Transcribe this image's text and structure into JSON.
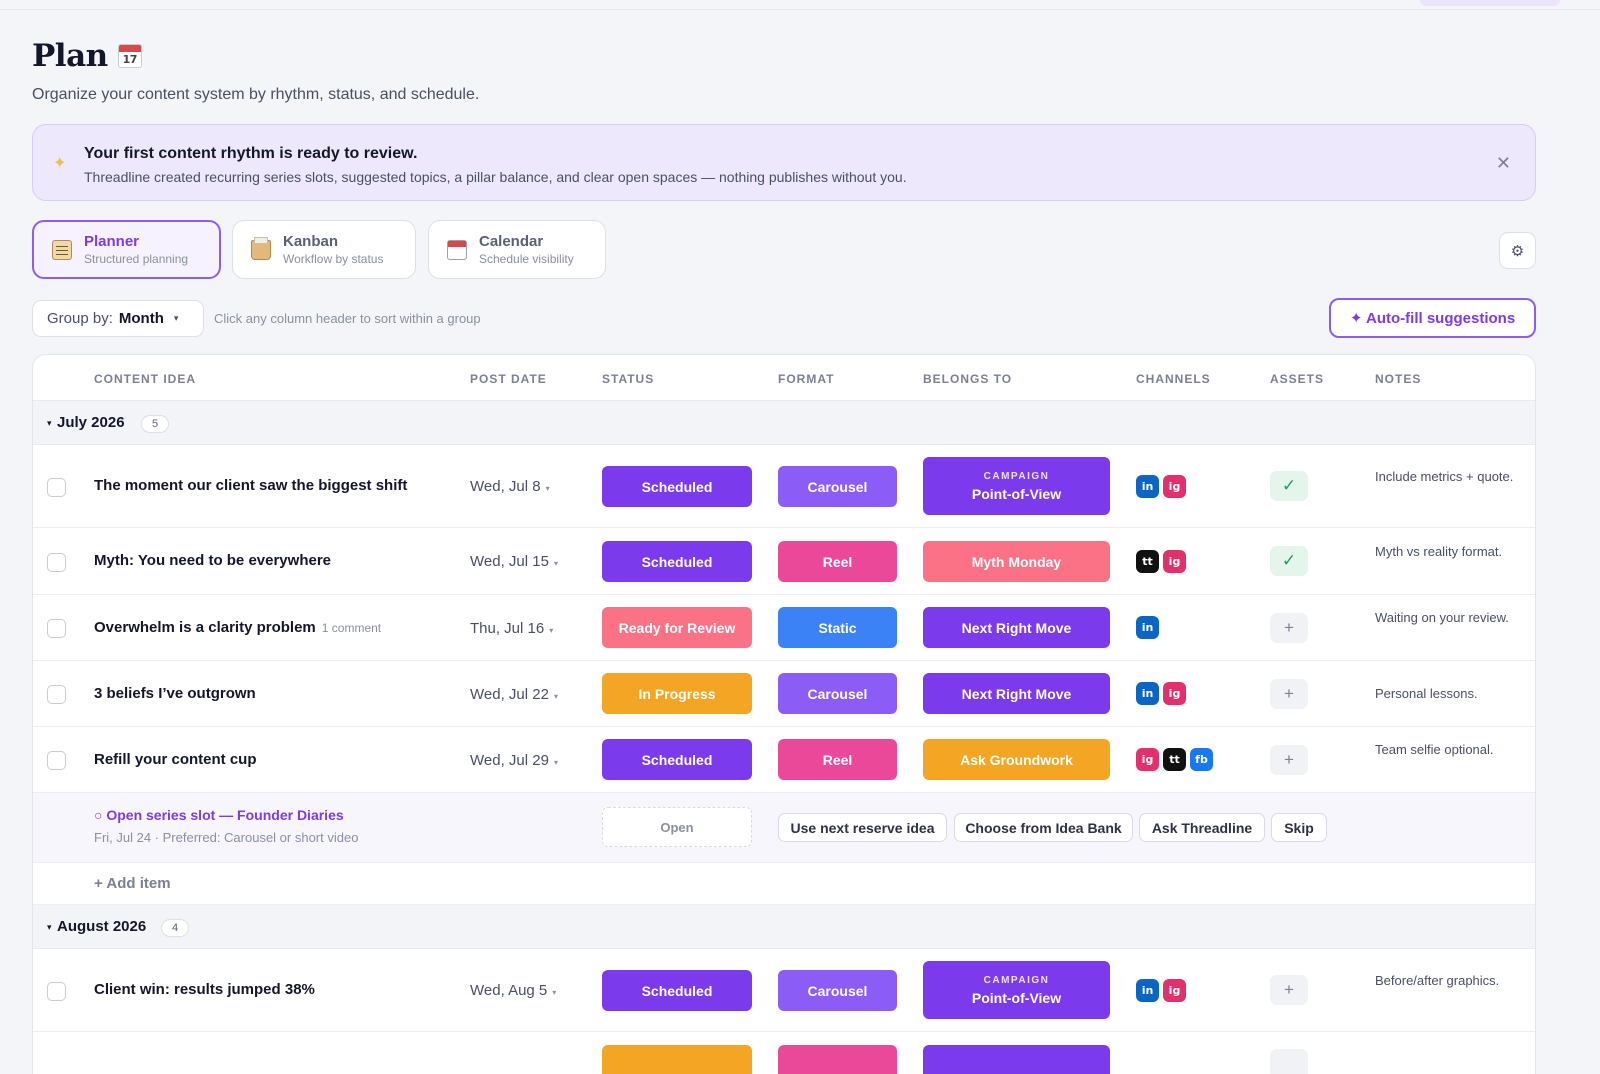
{
  "page": {
    "title": "Plan",
    "title_icon_text": "17",
    "subtitle": "Organize your content system by rhythm, status, and schedule."
  },
  "banner": {
    "icon": "sparkle-icon",
    "title": "Your first content rhythm is ready to review.",
    "text": "Threadline created recurring series slots, suggested topics, a pillar balance, and clear open spaces — nothing publishes without you.",
    "close": "✕"
  },
  "views": [
    {
      "label": "Planner",
      "sub": "Structured planning",
      "icon": "clipboard-icon"
    },
    {
      "label": "Kanban",
      "sub": "Workflow by status",
      "icon": "card-box-icon"
    },
    {
      "label": "Calendar",
      "sub": "Schedule visibility",
      "icon": "calendar-icon"
    }
  ],
  "settings_icon": "⚙",
  "toolbar": {
    "groupby_label": "Group by:",
    "groupby_value": "Month",
    "groupby_caret": "▾",
    "sort_hint": "Click any column header to sort within a group",
    "autofill": "✦ Auto-fill suggestions"
  },
  "columns": [
    "CONTENT IDEA",
    "POST DATE",
    "STATUS",
    "FORMAT",
    "BELONGS TO",
    "CHANNELS",
    "ASSETS",
    "NOTES"
  ],
  "colors": {
    "scheduled": "#7c3aed",
    "ready_for_review": "#fb7185",
    "in_progress": "#f5a524",
    "carousel": "#8b5cf6",
    "reel": "#ec4899",
    "static": "#3b82f6",
    "campaign": "#7c3aed",
    "myth_monday": "#fb7185",
    "next_right_move": "#7c3aed",
    "ask_groundwork": "#f5a524"
  },
  "groups": [
    {
      "label": "July 2026",
      "count": "5",
      "caret": "▾",
      "rows": [
        {
          "title": "The moment our client saw the biggest shift",
          "comment": "",
          "date": "Wed, Jul 8",
          "status": "Scheduled",
          "format": "Carousel",
          "belongs_tag": "CAMPAIGN",
          "belongs": "Point-of-View",
          "channels": [
            "in",
            "ig"
          ],
          "asset": "✓",
          "notes": "Include metrics + quote."
        },
        {
          "title": "Myth: You need to be everywhere",
          "comment": "",
          "date": "Wed, Jul 15",
          "status": "Scheduled",
          "format": "Reel",
          "belongs_tag": "",
          "belongs": "Myth Monday",
          "channels": [
            "tt",
            "ig"
          ],
          "asset": "✓",
          "notes": "Myth vs reality format."
        },
        {
          "title": "Overwhelm is a clarity problem",
          "comment": "1 comment",
          "date": "Thu, Jul 16",
          "status": "Ready for Review",
          "format": "Static",
          "belongs_tag": "",
          "belongs": "Next Right Move",
          "channels": [
            "in"
          ],
          "asset": "+",
          "notes": "Waiting on your review."
        },
        {
          "title": "3 beliefs I’ve outgrown",
          "comment": "",
          "date": "Wed, Jul 22",
          "status": "In Progress",
          "format": "Carousel",
          "belongs_tag": "",
          "belongs": "Next Right Move",
          "channels": [
            "in",
            "ig"
          ],
          "asset": "+",
          "notes": "Personal lessons."
        },
        {
          "title": "Refill your content cup",
          "comment": "",
          "date": "Wed, Jul 29",
          "status": "Scheduled",
          "format": "Reel",
          "belongs_tag": "",
          "belongs": "Ask Groundwork",
          "channels": [
            "ig",
            "tt",
            "fb"
          ],
          "asset": "+",
          "notes": "Team selfie optional."
        }
      ],
      "slot": {
        "title": "○ Open series slot — Founder Diaries",
        "sub": "Fri, Jul 24 · Preferred: Carousel or short video",
        "status": "Open",
        "actions": [
          "Use next reserve idea",
          "Choose from Idea Bank",
          "Ask Threadline",
          "Skip"
        ]
      },
      "add_item": "+ Add item"
    },
    {
      "label": "August 2026",
      "count": "4",
      "caret": "▾",
      "rows": [
        {
          "title": "Client win: results jumped 38%",
          "comment": "",
          "date": "Wed, Aug 5",
          "status": "Scheduled",
          "format": "Carousel",
          "belongs_tag": "CAMPAIGN",
          "belongs": "Point-of-View",
          "channels": [
            "in",
            "ig"
          ],
          "asset": "+",
          "notes": "Before/after graphics."
        }
      ]
    }
  ]
}
